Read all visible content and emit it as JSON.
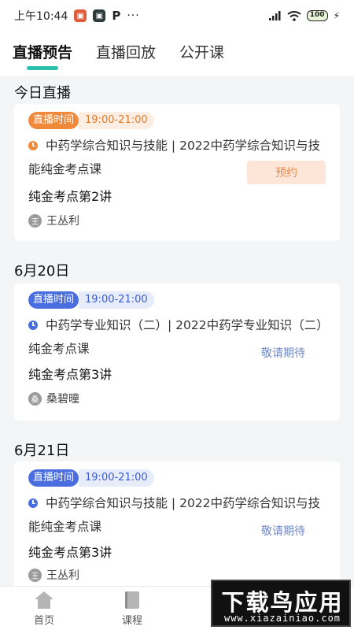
{
  "status_bar": {
    "time": "上午10:44",
    "app_p": "P",
    "more": "···",
    "signal": "signal",
    "wifi": "wifi",
    "battery": "100",
    "charging": "⚡"
  },
  "tabs": [
    {
      "label": "直播预告",
      "active": true
    },
    {
      "label": "直播回放",
      "active": false
    },
    {
      "label": "公开课",
      "active": false
    }
  ],
  "sections": [
    {
      "title": "今日直播",
      "card": {
        "tag_label": "直播时间",
        "tag_time": "19:00-21:00",
        "tag_color": "orange",
        "course_title": "中药学综合知识与技能 | 2022中药学综合知识与技能纯金考点课",
        "lesson": "纯金考点第2讲",
        "teacher_avatar": "王",
        "teacher": "王丛利",
        "action": "预约"
      }
    },
    {
      "title": "6月20日",
      "card": {
        "tag_label": "直播时间",
        "tag_time": "19:00-21:00",
        "tag_color": "blue",
        "course_title": "中药学专业知识（二）| 2022中药学专业知识（二）纯金考点课",
        "lesson": "纯金考点第3讲",
        "teacher_avatar": "桑",
        "teacher": "桑碧曈",
        "action": "敬请期待"
      }
    },
    {
      "title": "6月21日",
      "card": {
        "tag_label": "直播时间",
        "tag_time": "19:00-21:00",
        "tag_color": "blue",
        "course_title": "中药学综合知识与技能 | 2022中药学综合知识与技能纯金考点课",
        "lesson": "纯金考点第3讲",
        "teacher_avatar": "王",
        "teacher": "王丛利",
        "action": "敬请期待"
      }
    }
  ],
  "bottom_nav": [
    {
      "label": "首页",
      "icon": "home-icon"
    },
    {
      "label": "课程",
      "icon": "book-icon"
    }
  ],
  "watermark": {
    "main": "下载鸟应用",
    "sub": "www.xiazainiao.com"
  },
  "colors": {
    "accent": "#2bbfae",
    "orange": "#f08a3a",
    "blue": "#4a6ee0"
  }
}
